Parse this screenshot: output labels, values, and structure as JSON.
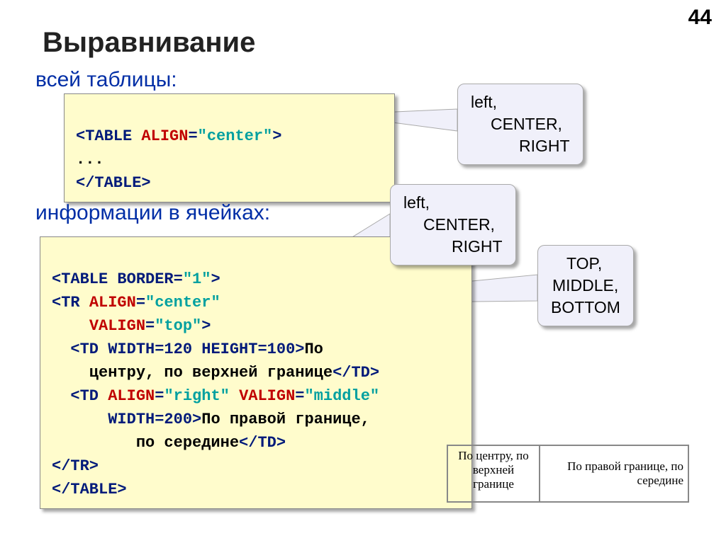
{
  "page_number": "44",
  "title": "Выравнивание",
  "subtitle_table": "всей таблицы:",
  "subtitle_cells": "информации в ячейках:",
  "code1": {
    "l1_open": "<TABLE ",
    "l1_attr": "ALIGN",
    "l1_eq": "=",
    "l1_val": "\"center\"",
    "l1_close": ">",
    "l2": "...",
    "l3": "</TABLE>"
  },
  "code2": {
    "l1_open": "<TABLE ",
    "l1_attr": "BORDER",
    "l1_eq": "=",
    "l1_val": "\"1\"",
    "l1_close": ">",
    "l2_open": "<TR ",
    "l2_attr": "ALIGN",
    "l2_eq": "=",
    "l2_val": "\"center\"",
    "l3_sp": "    ",
    "l3_attr": "VALIGN",
    "l3_eq": "=",
    "l3_val": "\"top\"",
    "l3_close": ">",
    "l4_a": "  <TD ",
    "l4_attr1": "WIDTH",
    "l4_eq1": "=120 ",
    "l4_attr2": "HEIGHT",
    "l4_eq2": "=100>",
    "l4_text": "По",
    "l5_text": "    центру, по верхней границе",
    "l5_close": "</TD>",
    "l6_a": "  <TD ",
    "l6_attr1": "ALIGN",
    "l6_eq1": "=",
    "l6_val1": "\"right\" ",
    "l6_attr2": "VALIGN",
    "l6_eq2": "=",
    "l6_val2": "\"middle\"",
    "l7_sp": "      ",
    "l7_attr": "WIDTH",
    "l7_eq": "=200>",
    "l7_text": "По правой границе,",
    "l8_text": "         по середине",
    "l8_close": "</TD>",
    "l9": "</TR>",
    "l10": "</TABLE>"
  },
  "callout_align1": {
    "l1": "left,",
    "l2": "CENTER,",
    "l3": "RIGHT"
  },
  "callout_align2": {
    "l1": "left,",
    "l2": "CENTER,",
    "l3": "RIGHT"
  },
  "callout_valign": {
    "l1": "TOP,",
    "l2": "MIDDLE,",
    "l3": "BOTTOM"
  },
  "example": {
    "cell1": "По центру, по\nверхней\nгранице",
    "cell2": "По правой границе, по\nсередине"
  }
}
